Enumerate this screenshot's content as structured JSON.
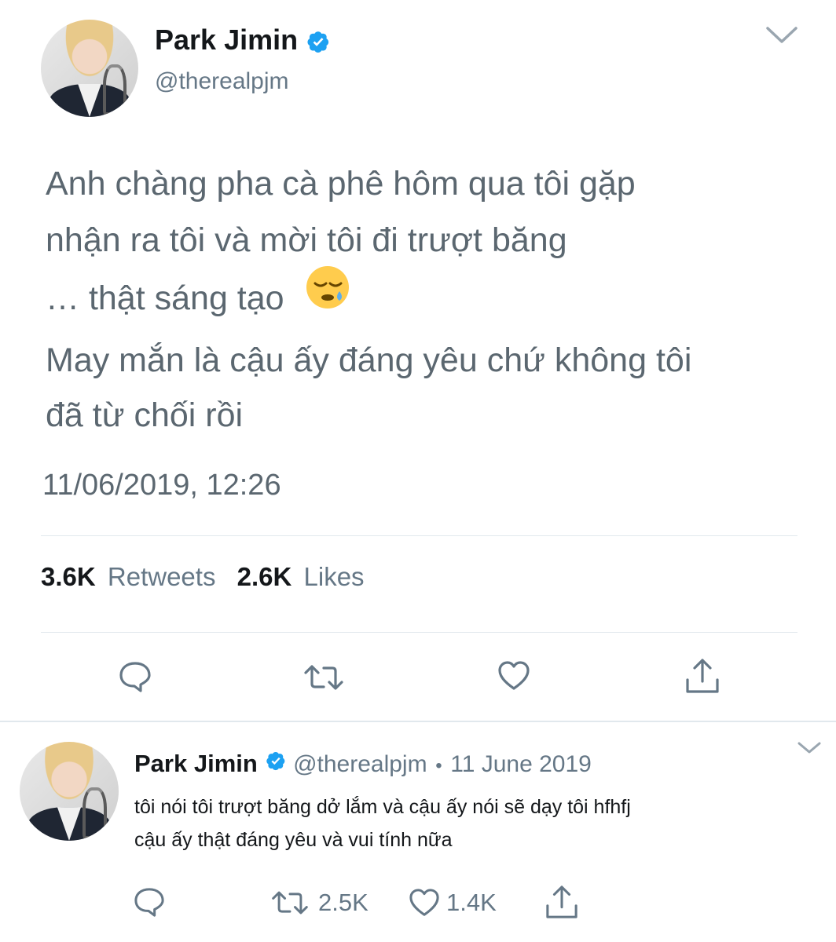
{
  "main_tweet": {
    "author_name": "Park Jimin",
    "author_handle": "@therealpjm",
    "text_lines": [
      "Anh chàng pha cà phê hôm qua tôi gặp",
      "nhận ra tôi và mời tôi đi trượt băng",
      "… thật sáng tạo",
      "May mắn là cậu ấy đáng yêu chứ không tôi",
      "đã từ chối rồi"
    ],
    "emoji": "😪",
    "timestamp": "11/06/2019, 12:26",
    "stats": {
      "retweets_count": "3.6K",
      "retweets_label": "Retweets",
      "likes_count": "2.6K",
      "likes_label": "Likes"
    },
    "actions": [
      "reply-icon",
      "retweet-icon",
      "like-icon",
      "share-icon"
    ]
  },
  "reply_tweet": {
    "author_name": "Park Jimin",
    "author_handle": "@therealpjm",
    "separator": "•",
    "date": "11 June 2019",
    "text_lines": [
      "tôi nói tôi trượt băng dở lắm và cậu ấy nói sẽ dạy tôi hfhfj",
      "cậu ấy thật đáng yêu và vui tính nữa"
    ],
    "retweet_count": "2.5K",
    "like_count": "1.4K"
  },
  "colors": {
    "verified": "#1da1f2",
    "text": "#14171a",
    "muted": "#657786",
    "icon": "#657786",
    "divider": "#e1e8ed"
  }
}
